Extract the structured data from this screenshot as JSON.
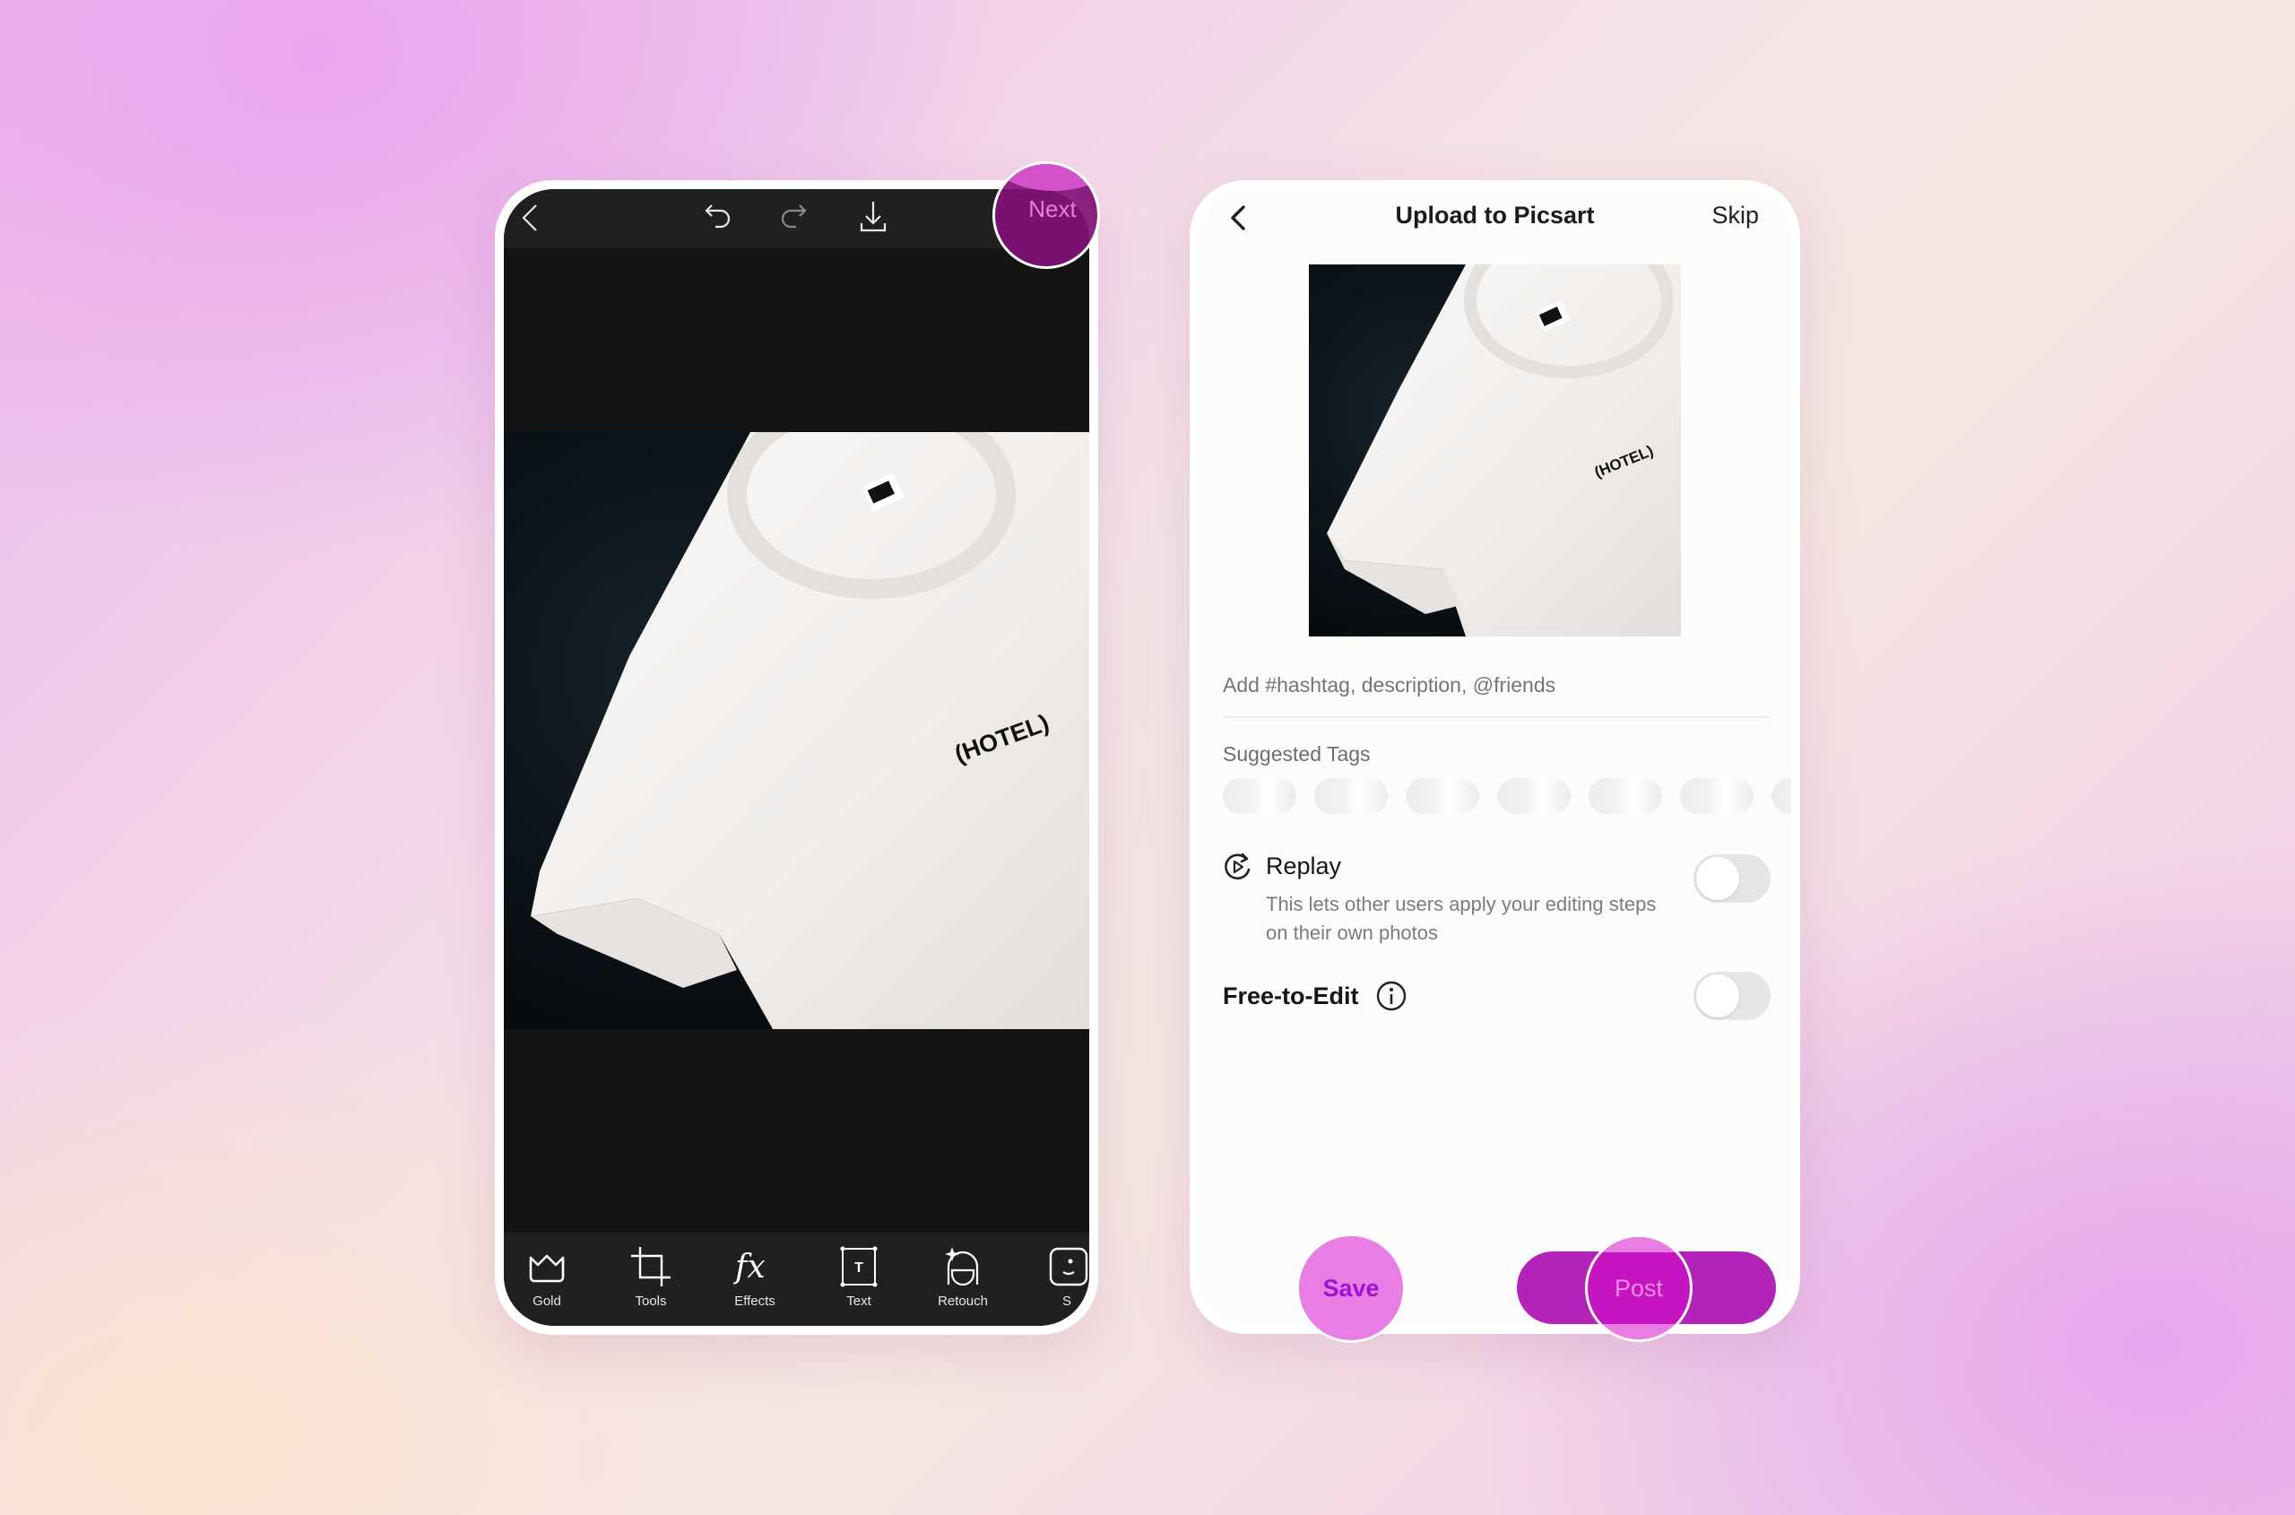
{
  "editor": {
    "toolbar_top": {
      "back_icon": "chevron-left-icon",
      "undo_icon": "undo-icon",
      "redo_icon": "redo-icon",
      "download_icon": "download-icon",
      "next_label": "Next"
    },
    "photo_alt": "White t-shirt with (HOTEL) print on dark fabric",
    "photo_print_text": "(HOTEL)",
    "tools": [
      {
        "label": "Gold",
        "icon": "crown-icon"
      },
      {
        "label": "Tools",
        "icon": "crop-icon"
      },
      {
        "label": "Effects",
        "icon": "fx-icon"
      },
      {
        "label": "Text",
        "icon": "text-icon"
      },
      {
        "label": "Retouch",
        "icon": "retouch-face-icon"
      },
      {
        "label": "S",
        "icon": "sticker-icon"
      }
    ]
  },
  "upload": {
    "header": {
      "back_icon": "chevron-left-icon",
      "title": "Upload to Picsart",
      "skip_label": "Skip"
    },
    "thumbnail_print_text": "(HOTEL)",
    "description": {
      "value": "",
      "placeholder": "Add #hashtag, description, @friends"
    },
    "suggested_tags": {
      "label": "Suggested Tags",
      "loading_placeholders": 7
    },
    "replay": {
      "icon": "replay-icon",
      "title": "Replay",
      "description": "This lets other users apply your editing steps on their own photos",
      "enabled": false
    },
    "free_to_edit": {
      "title": "Free-to-Edit",
      "info_icon": "info-icon",
      "enabled": false
    },
    "save_label": "Save",
    "post_label": "Post"
  },
  "colors": {
    "accent_purple": "#b224b8",
    "touch_highlight": "#e87de3",
    "save_text": "#9b14d6",
    "editor_dark": "#141414"
  }
}
